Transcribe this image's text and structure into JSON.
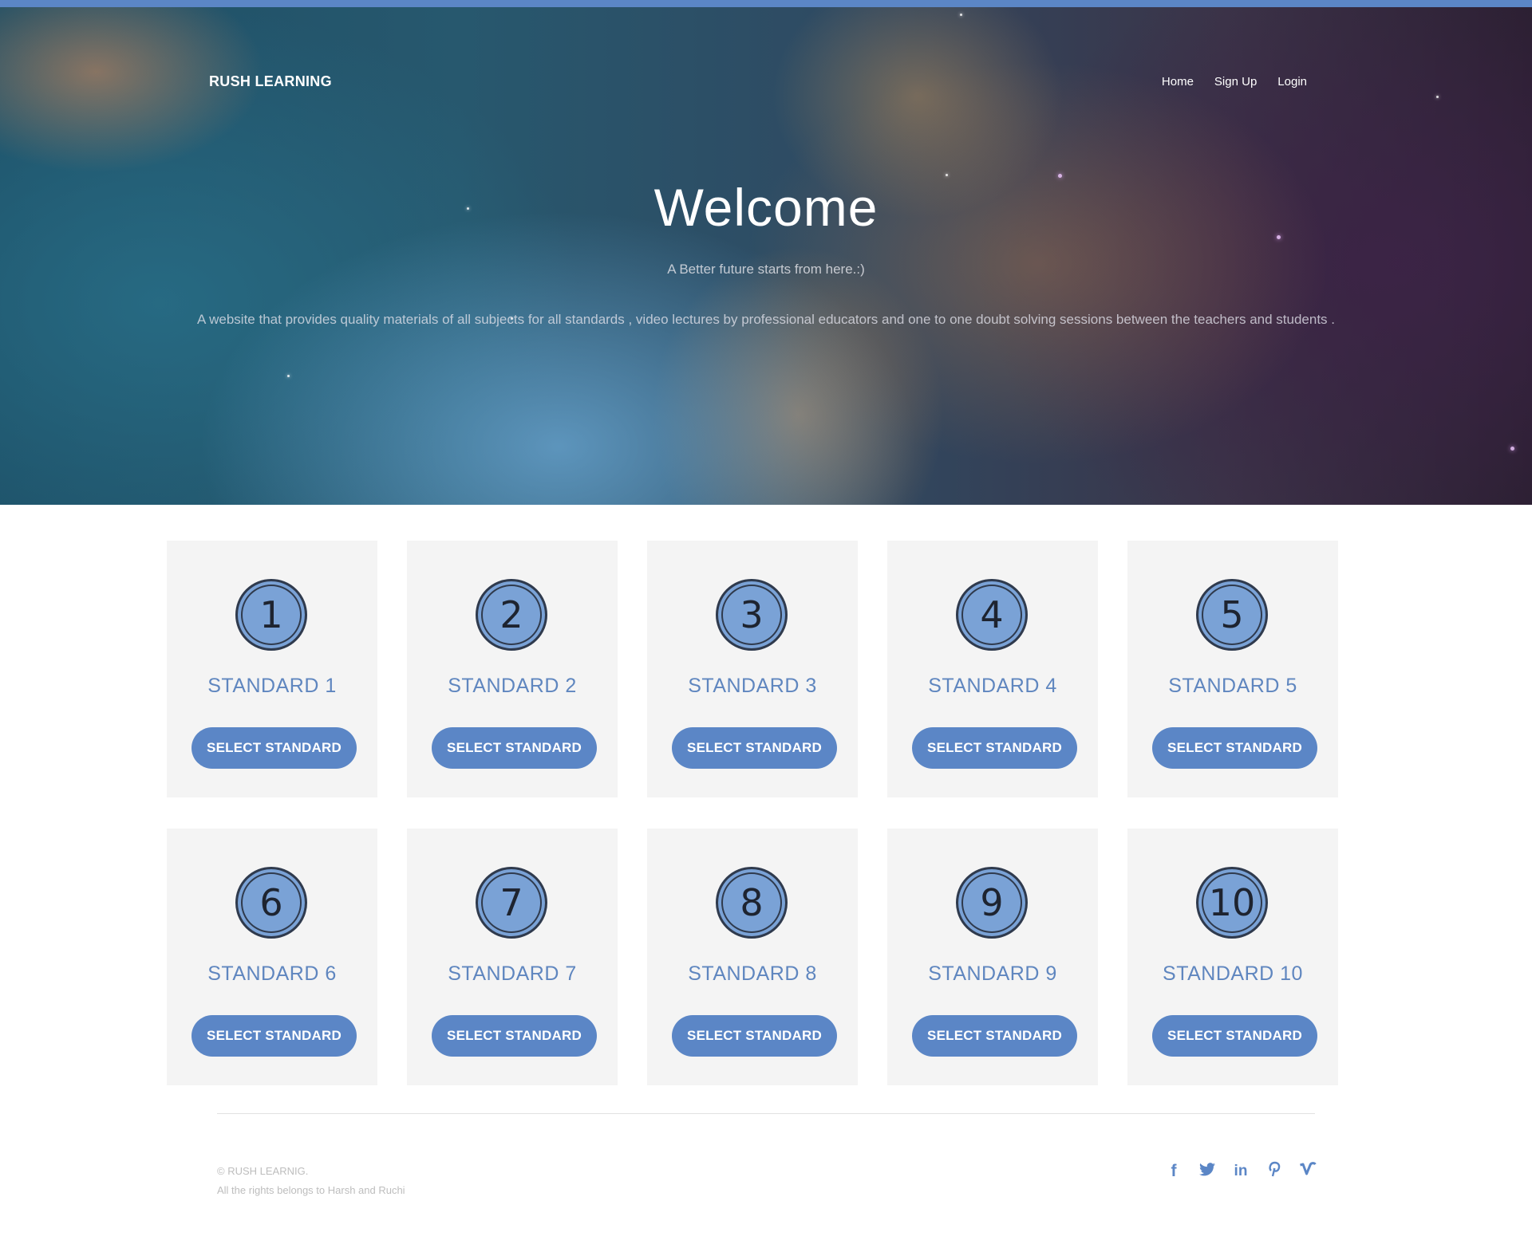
{
  "brand": "RUSH LEARNING",
  "nav": {
    "home": "Home",
    "signup": "Sign Up",
    "login": "Login"
  },
  "hero": {
    "title": "Welcome",
    "tagline": "A Better future starts from here.:)",
    "description": "A website that provides quality materials of all subjects for all standards , video lectures by professional educators and one to one doubt solving sessions between the teachers and students ."
  },
  "standards": [
    {
      "number": "1",
      "label": "STANDARD 1",
      "button": "SELECT STANDARD"
    },
    {
      "number": "2",
      "label": "STANDARD 2",
      "button": "SELECT STANDARD"
    },
    {
      "number": "3",
      "label": "STANDARD 3",
      "button": "SELECT STANDARD"
    },
    {
      "number": "4",
      "label": "STANDARD 4",
      "button": "SELECT STANDARD"
    },
    {
      "number": "5",
      "label": "STANDARD 5",
      "button": "SELECT STANDARD"
    },
    {
      "number": "6",
      "label": "STANDARD 6",
      "button": "SELECT STANDARD"
    },
    {
      "number": "7",
      "label": "STANDARD 7",
      "button": "SELECT STANDARD"
    },
    {
      "number": "8",
      "label": "STANDARD 8",
      "button": "SELECT STANDARD"
    },
    {
      "number": "9",
      "label": "STANDARD 9",
      "button": "SELECT STANDARD"
    },
    {
      "number": "10",
      "label": "STANDARD 10",
      "button": "SELECT STANDARD"
    }
  ],
  "footer": {
    "copyright": "© RUSH LEARNIG.",
    "rights": "All the rights belongs to Harsh and Ruchi",
    "social": [
      "facebook-icon",
      "twitter-icon",
      "linkedin-icon",
      "pinterest-icon",
      "vimeo-icon"
    ]
  },
  "colors": {
    "accent": "#5b86c6",
    "card_bg": "#f4f4f4",
    "badge": "#7aa2d6"
  }
}
